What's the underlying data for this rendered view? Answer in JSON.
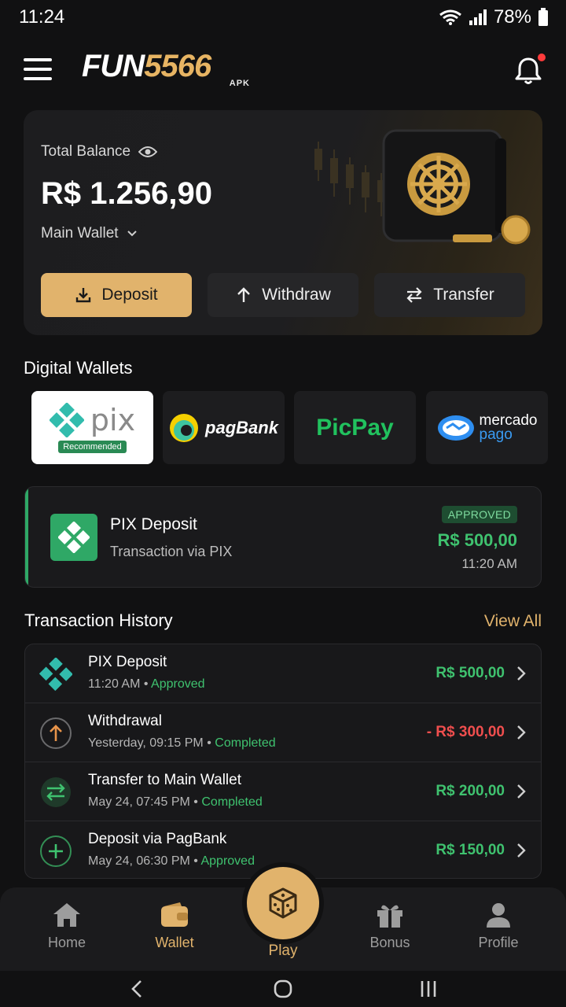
{
  "status_bar": {
    "time": "11:24",
    "battery": "78%"
  },
  "header": {
    "logo_primary": "FUN",
    "logo_secondary": "5566",
    "logo_sub": "APK"
  },
  "balance": {
    "label": "Total Balance",
    "amount": "R$ 1.256,90",
    "wallet": "Main Wallet",
    "actions": {
      "deposit": "Deposit",
      "withdraw": "Withdraw",
      "transfer": "Transfer"
    }
  },
  "digital_wallets": {
    "title": "Digital Wallets",
    "items": [
      {
        "name": "pix",
        "badge": "Recommended"
      },
      {
        "name": "pagBank"
      },
      {
        "name": "PicPay"
      },
      {
        "name_a": "mercado",
        "name_b": "pago"
      }
    ]
  },
  "pix_deposit": {
    "title": "PIX Deposit",
    "subtitle": "Transaction via PIX",
    "status": "APPROVED",
    "amount": "R$ 500,00",
    "time": "11:20 AM"
  },
  "history": {
    "title": "Transaction History",
    "view_all": "View All",
    "items": [
      {
        "title": "PIX Deposit",
        "time": "11:20 AM",
        "status": "Approved",
        "amount": "R$ 500,00",
        "icon": "pix-icon"
      },
      {
        "title": "Withdrawal",
        "time": "Yesterday, 09:15 PM",
        "status": "Completed",
        "amount": "- R$ 300,00",
        "icon": "withdraw-arrow-icon"
      },
      {
        "title": "Transfer to Main Wallet",
        "time": "May 24, 07:45 PM",
        "status": "Completed",
        "amount": "R$ 200,00",
        "icon": "transfer-icon"
      },
      {
        "title": "Deposit via PagBank",
        "time": "May 24, 06:30 PM",
        "status": "Approved",
        "amount": "R$ 150,00",
        "icon": "plus-icon"
      }
    ],
    "separator": "•"
  },
  "bottom_nav": {
    "home": "Home",
    "wallet": "Wallet",
    "play": "Play",
    "bonus": "Bonus",
    "profile": "Profile"
  },
  "colors": {
    "accent": "#e1b36c",
    "positive": "#3fc26f",
    "negative": "#f04e4e",
    "background": "#111112"
  }
}
